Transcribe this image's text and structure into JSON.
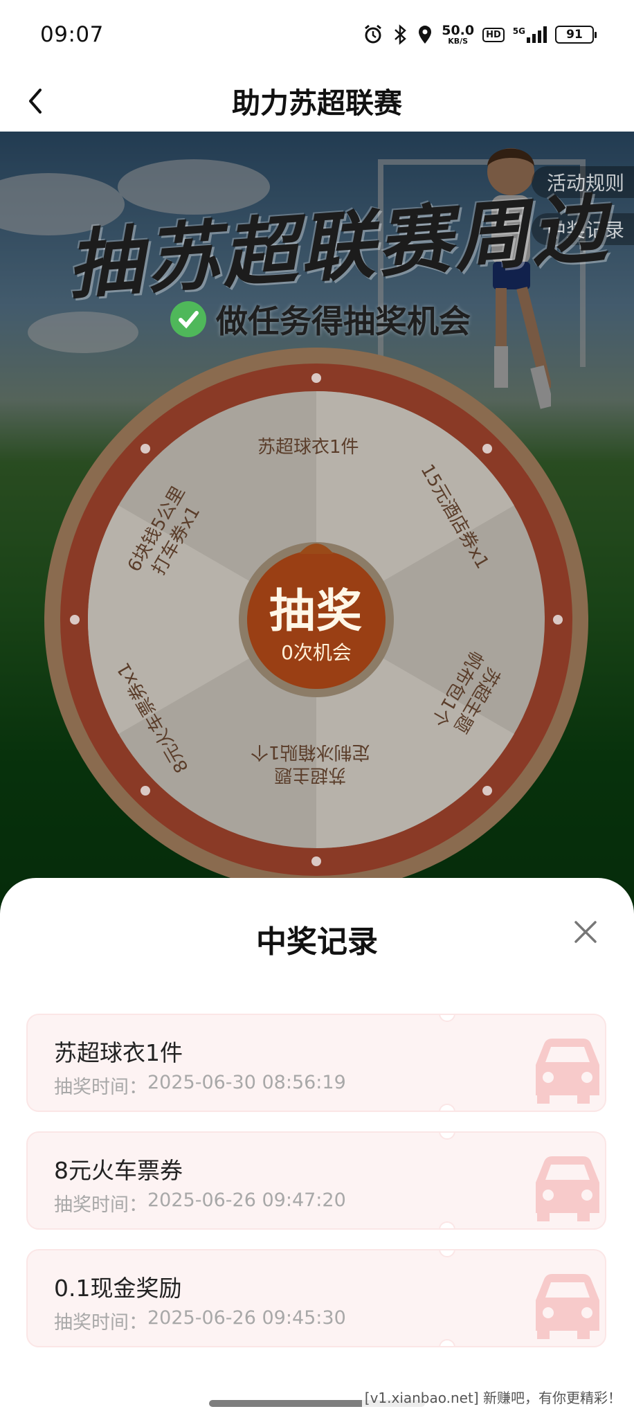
{
  "status_bar": {
    "time": "09:07",
    "net_speed_value": "50.0",
    "net_speed_unit": "KB/S",
    "hd": "HD",
    "signal_label": "5G",
    "battery": "91"
  },
  "nav": {
    "title": "助力苏超联赛"
  },
  "promo": {
    "title": "抽苏超联赛周边",
    "subtitle": "做任务得抽奖机会",
    "rules_button": "活动规则",
    "records_button": "中奖记录",
    "prizes": [
      "苏超球衣1件",
      "15元酒店券x1",
      "苏超主题",
      "帆布包1个",
      "苏超主题",
      "定制冰箱贴1个",
      "8元火车票券x1",
      "6块钱5公里",
      "打车券x1"
    ],
    "draw_label": "抽奖",
    "draw_chances": "0次机会"
  },
  "sheet": {
    "title": "中奖记录",
    "time_label": "抽奖时间：",
    "records": [
      {
        "name": "苏超球衣1件",
        "time": "2025-06-30 08:56:19"
      },
      {
        "name": "8元火车票券",
        "time": "2025-06-26 09:47:20"
      },
      {
        "name": "0.1现金奖励",
        "time": "2025-06-26 09:45:30"
      }
    ]
  },
  "watermark": "[v1.xianbao.net] 新赚吧，有你更精彩！",
  "colors": {
    "wheel_rim": "#c8371f",
    "wheel_outer": "#e9b48e",
    "draw_button": "#e8641c",
    "record_bg": "#fdf3f3",
    "car_icon": "#f7caca"
  }
}
